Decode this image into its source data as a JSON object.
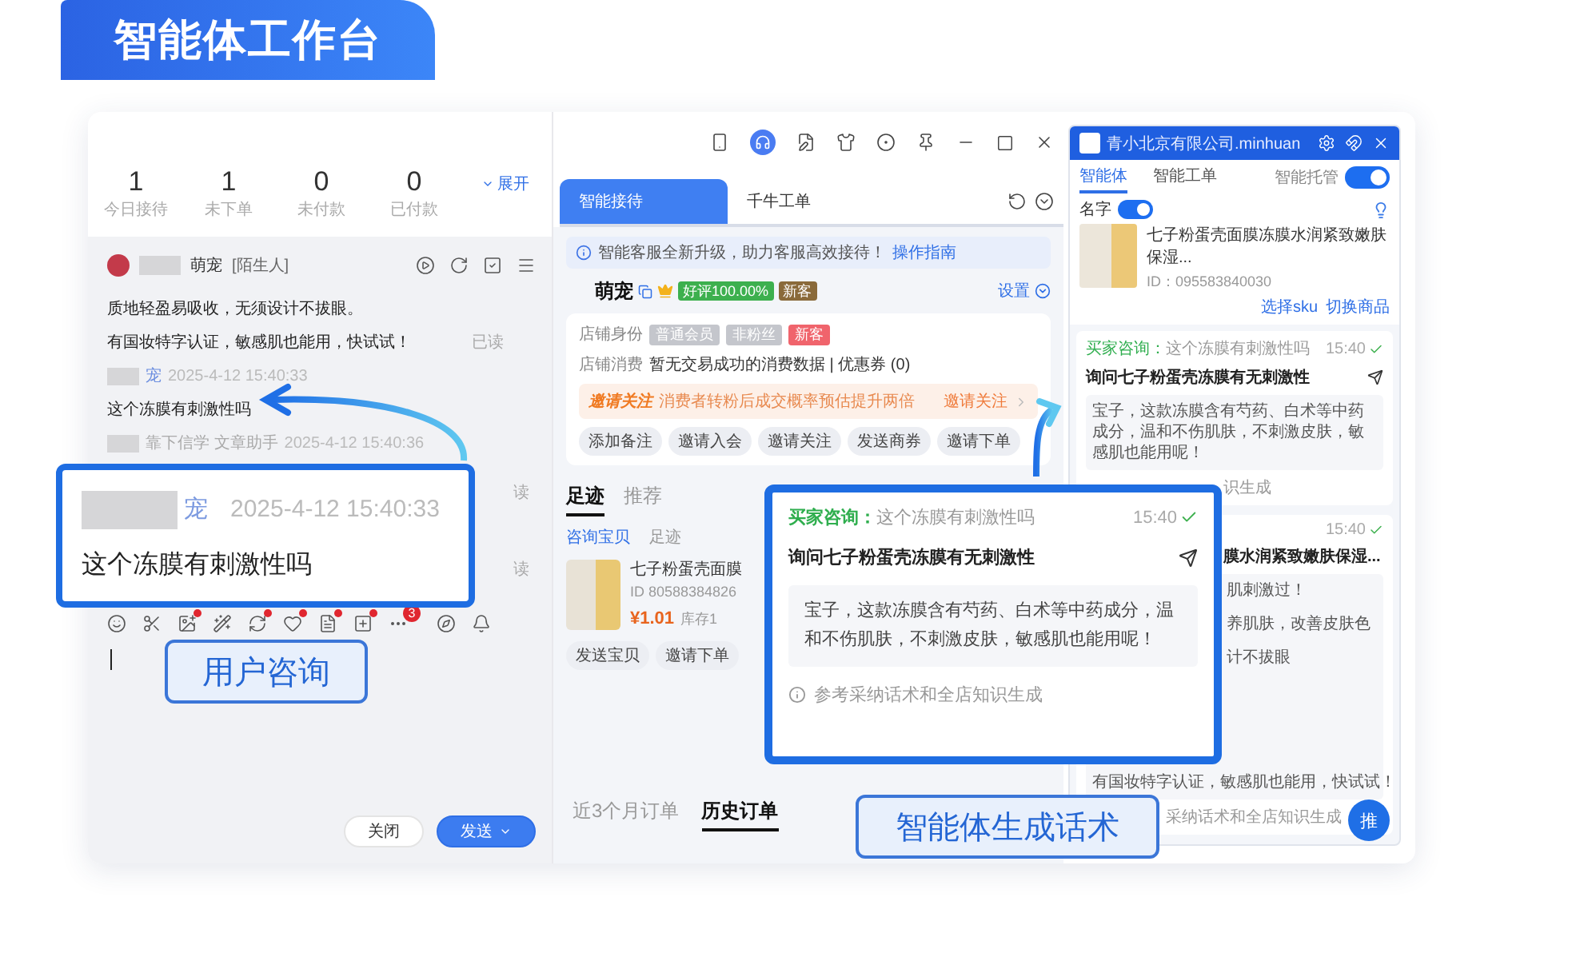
{
  "banner": {
    "title": "智能体工作台"
  },
  "stats": [
    {
      "value": "1",
      "label": "今日接待"
    },
    {
      "value": "1",
      "label": "未下单"
    },
    {
      "value": "0",
      "label": "未付款"
    },
    {
      "value": "0",
      "label": "已付款"
    }
  ],
  "stats_toggle": "展开",
  "chat": {
    "contact": "萌宠",
    "contact_tag": "[陌生人]",
    "messages": [
      {
        "kind": "text",
        "text": "质地轻盈易吸收，无须设计不拔眼。"
      },
      {
        "kind": "text",
        "text": "有国妆特字认证，敏感肌也能用，快试试！",
        "status": "已读"
      },
      {
        "kind": "meta",
        "name": "宠",
        "time": "2025-4-12 15:40:33"
      },
      {
        "kind": "text",
        "text": "这个冻膜有刺激性吗"
      },
      {
        "kind": "meta",
        "name": "靠下信学 文章助手",
        "time": "2025-4-12 15:40:36"
      }
    ],
    "read_marks": [
      "读",
      "读"
    ],
    "composer_badge": "3",
    "buttons": [
      {
        "label": "关闭",
        "kind": "plain"
      },
      {
        "label": "发送",
        "kind": "primary"
      }
    ]
  },
  "middle": {
    "tabs": [
      {
        "label": "智能接待",
        "selected": true
      },
      {
        "label": "千牛工单",
        "selected": false
      }
    ],
    "notice": {
      "text": "智能客服全新升级，助力客服高效接待！",
      "link": "操作指南"
    },
    "shop": {
      "name": "萌宠",
      "rating": "好评100.00%",
      "tag": "新客",
      "settings": "设置"
    },
    "identity": {
      "label": "店铺身份",
      "tags": [
        {
          "text": "普通会员",
          "kind": "grey"
        },
        {
          "text": "非粉丝",
          "kind": "grey"
        },
        {
          "text": "新客",
          "kind": "red"
        }
      ]
    },
    "consumption": {
      "label": "店铺消费",
      "text": "暂无交易成功的消费数据 | 优惠券 (0)"
    },
    "promo": {
      "title": "邀请关注",
      "text": "消费者转粉后成交概率预估提升两倍",
      "action": "邀请关注"
    },
    "actions": [
      "添加备注",
      "邀请入会",
      "邀请关注",
      "发送商券",
      "邀请下单"
    ],
    "section_tabs": [
      {
        "label": "足迹",
        "selected": true
      },
      {
        "label": "推荐",
        "selected": false
      }
    ],
    "subtabs": [
      "咨询宝贝",
      "足迹"
    ],
    "product": {
      "title": "七子粉蛋壳面膜",
      "id": "ID 80588384826",
      "price": "¥1.01",
      "stock": "库存1"
    },
    "product_actions": [
      "发送宝贝",
      "邀请下单"
    ],
    "order_tabs": [
      {
        "label": "近3个月订单",
        "selected": false
      },
      {
        "label": "历史订单",
        "selected": true
      }
    ]
  },
  "assistant": {
    "title": "青小北京有限公司.minhuan",
    "tabs": [
      {
        "label": "智能体",
        "selected": true
      },
      {
        "label": "智能工单",
        "selected": false
      }
    ],
    "hosting": {
      "label": "智能托管",
      "on": true
    },
    "name_toggle": {
      "label": "名字",
      "on": true
    },
    "product": {
      "title": "七子粉蛋壳面膜冻膜水润紧致嫩肤保湿...",
      "id": "ID：095583840030",
      "links": [
        "选择sku",
        "切换商品"
      ]
    },
    "cards": [
      {
        "query_label": "买家咨询：",
        "query": "这个冻膜有刺激性吗",
        "time": "15:40",
        "intent": {
          "text": "询问七子粉蛋壳冻膜有无刺激性",
          "kind": "full"
        },
        "lines": [
          {
            "text": "宝子，这款冻膜含有芍药、白术等中药成分，温和不伤肌肤，不刺激皮肤，敏感肌也能用呢！",
            "kind": "full"
          }
        ],
        "footer": {
          "text": "识生成",
          "kind": "clipped"
        }
      },
      {
        "time": "15:40",
        "intent": {
          "text": "膜水润紧致嫩肤保湿...",
          "kind": "clipped"
        },
        "lines": [
          {
            "text": "肌刺激过！",
            "kind": "clipped"
          },
          {
            "text": "养肌肤，改善皮肤色",
            "kind": "clipped"
          },
          {
            "text": "计不拔眼",
            "kind": "clipped"
          },
          {
            "text": "有国妆特字认证，敏感肌也能用，快试试！",
            "kind": "full"
          }
        ],
        "footer": {
          "text": "采纳话术和全店知识生成",
          "kind": "clipped"
        }
      }
    ],
    "fab": "推"
  },
  "callouts": {
    "user": {
      "name": "宠",
      "time": "2025-4-12 15:40:33",
      "text": "这个冻膜有刺激性吗",
      "label": "用户咨询"
    },
    "agent": {
      "query_label": "买家咨询：",
      "query": "这个冻膜有刺激性吗",
      "time": "15:40",
      "intent": "询问七子粉蛋壳冻膜有无刺激性",
      "reply": "宝子，这款冻膜含有芍药、白术等中药成分，温和不伤肌肤，不刺激皮肤，敏感肌也能用呢！",
      "footer": "参考采纳话术和全店知识生成",
      "label": "智能体生成话术"
    }
  }
}
